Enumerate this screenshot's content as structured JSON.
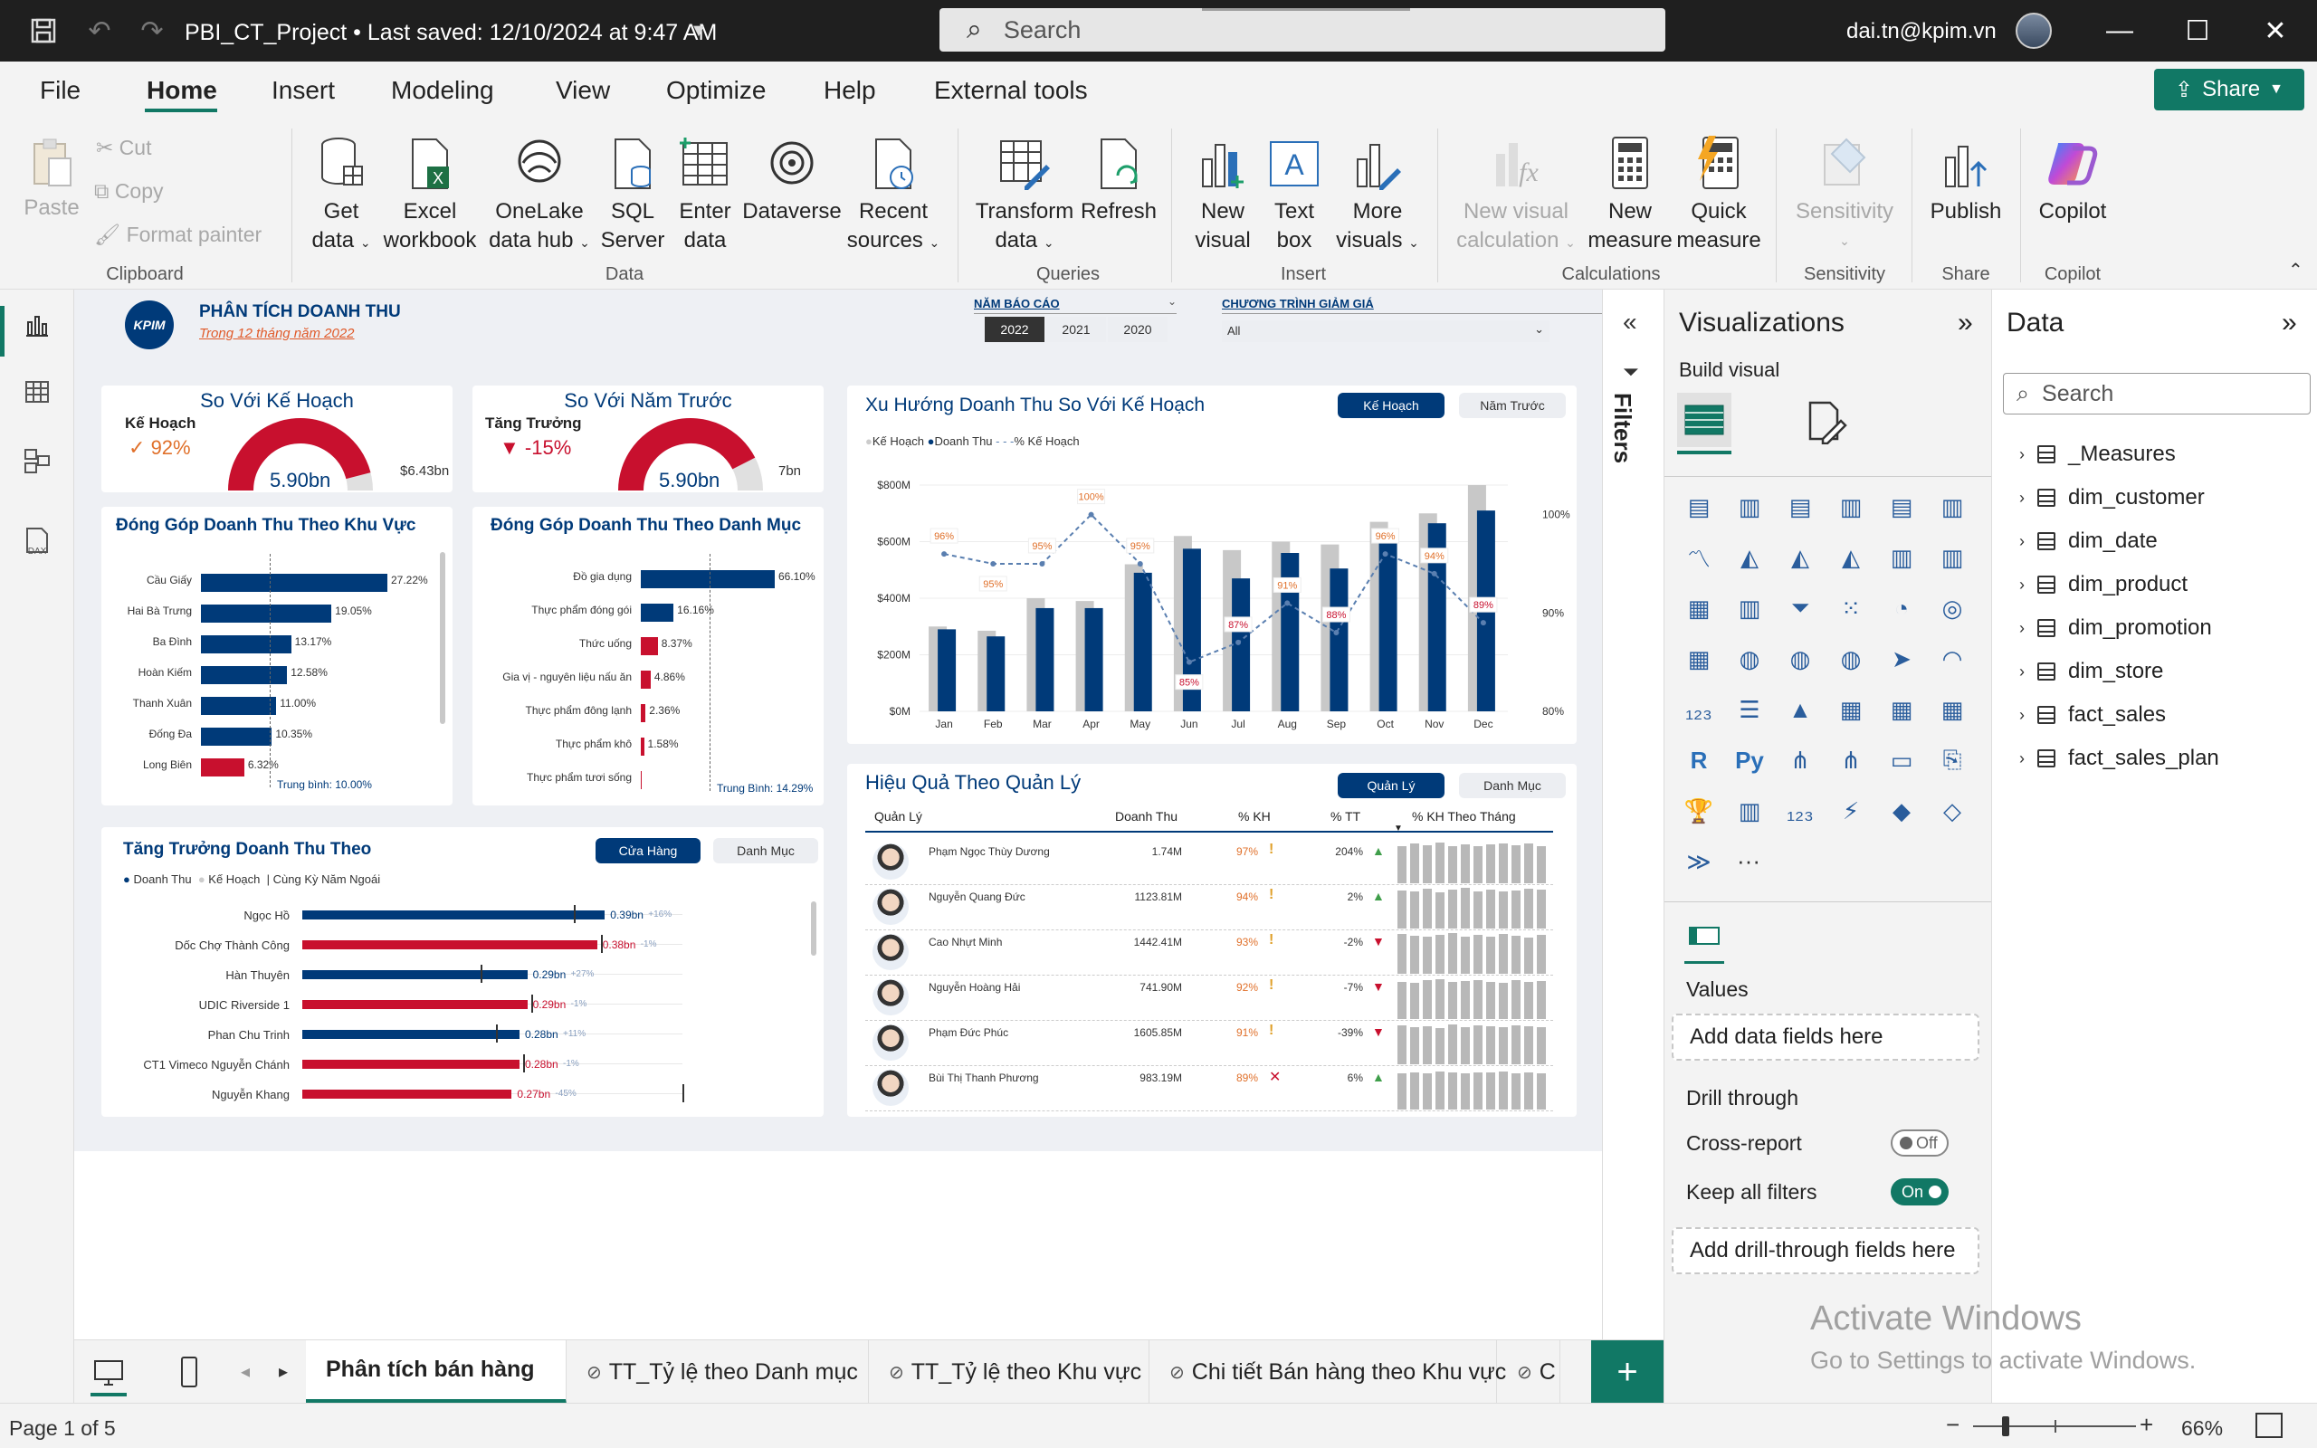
{
  "titlebar": {
    "doc_title": "PBI_CT_Project  •  Last saved: 12/10/2024 at 9:47 AM",
    "search_placeholder": "Search",
    "user_email": "dai.tn@kpim.vn"
  },
  "menu": {
    "items": [
      "File",
      "Home",
      "Insert",
      "Modeling",
      "View",
      "Optimize",
      "Help",
      "External tools"
    ],
    "share": "Share"
  },
  "ribbon": {
    "clipboard": {
      "paste": "Paste",
      "cut": "Cut",
      "copy": "Copy",
      "format_painter": "Format painter",
      "group": "Clipboard"
    },
    "data": {
      "get_data_1": "Get",
      "get_data_2": "data",
      "excel_1": "Excel",
      "excel_2": "workbook",
      "onelake_1": "OneLake",
      "onelake_2": "data hub",
      "sql_1": "SQL",
      "sql_2": "Server",
      "enter_1": "Enter",
      "enter_2": "data",
      "dataverse": "Dataverse",
      "recent_1": "Recent",
      "recent_2": "sources",
      "group": "Data"
    },
    "queries": {
      "transform_1": "Transform",
      "transform_2": "data",
      "refresh": "Refresh",
      "group": "Queries"
    },
    "insert": {
      "new_visual_1": "New",
      "new_visual_2": "visual",
      "text_box_1": "Text",
      "text_box_2": "box",
      "more_visuals_1": "More",
      "more_visuals_2": "visuals",
      "group": "Insert"
    },
    "calculations": {
      "new_visual_calc_1": "New visual",
      "new_visual_calc_2": "calculation",
      "new_measure_1": "New",
      "new_measure_2": "measure",
      "quick_measure_1": "Quick",
      "quick_measure_2": "measure",
      "group": "Calculations"
    },
    "sensitivity": {
      "label": "Sensitivity",
      "group": "Sensitivity"
    },
    "share": {
      "publish": "Publish",
      "group": "Share"
    },
    "copilot": {
      "label": "Copilot",
      "group": "Copilot"
    }
  },
  "report": {
    "logo_text": "KPIM",
    "title": "PHÂN TÍCH DOANH THU",
    "subtitle": "Trong 12 tháng năm 2022",
    "year_slicer": {
      "label": "NĂM BÁO CÁO",
      "options": [
        "2022",
        "2021",
        "2020"
      ],
      "selected": "2022"
    },
    "promo_slicer": {
      "label": "CHƯƠNG TRÌNH GIẢM GIÁ",
      "value": "All"
    },
    "gauge_plan": {
      "title": "So Với Kế Hoạch",
      "label": "Kế Hoạch",
      "pct": "92%",
      "pct_mark": "✓",
      "value": "5.90bn",
      "target": "$6.43bn",
      "fill": 0.92
    },
    "gauge_prev": {
      "title": "So Với Năm Trước",
      "label": "Tăng Trưởng",
      "pct": "-15%",
      "pct_mark": "▼",
      "value": "5.90bn",
      "target": "7bn",
      "fill": 0.85
    },
    "region": {
      "title": "Đóng Góp Doanh Thu Theo Khu Vực",
      "avg": "Trung bình: 10.00%",
      "rows": [
        {
          "name": "Cầu Giấy",
          "label": "27.22%",
          "value": 27.22,
          "color": "#003a79"
        },
        {
          "name": "Hai Bà Trưng",
          "label": "19.05%",
          "value": 19.05,
          "color": "#003a79"
        },
        {
          "name": "Ba Đình",
          "label": "13.17%",
          "value": 13.17,
          "color": "#003a79"
        },
        {
          "name": "Hoàn Kiếm",
          "label": "12.58%",
          "value": 12.58,
          "color": "#003a79"
        },
        {
          "name": "Thanh Xuân",
          "label": "11.00%",
          "value": 11.0,
          "color": "#003a79"
        },
        {
          "name": "Đống Đa",
          "label": "10.35%",
          "value": 10.35,
          "color": "#003a79"
        },
        {
          "name": "Long Biên",
          "label": "6.32%",
          "value": 6.32,
          "color": "#c8102e"
        }
      ]
    },
    "category": {
      "title": "Đóng Góp Doanh Thu Theo Danh Mục",
      "avg": "Trung Bình: 14.29%",
      "rows": [
        {
          "name": "Đồ gia dụng",
          "label": "66.10%",
          "value": 66.1,
          "color": "#003a79"
        },
        {
          "name": "Thực phẩm đóng gói",
          "label": "16.16%",
          "value": 16.16,
          "color": "#003a79"
        },
        {
          "name": "Thức uống",
          "label": "8.37%",
          "value": 8.37,
          "color": "#c8102e"
        },
        {
          "name": "Gia vị - nguyên liệu nấu ăn",
          "label": "4.86%",
          "value": 4.86,
          "color": "#c8102e"
        },
        {
          "name": "Thực phẩm đông lạnh",
          "label": "2.36%",
          "value": 2.36,
          "color": "#c8102e"
        },
        {
          "name": "Thực phẩm khô",
          "label": "1.58%",
          "value": 1.58,
          "color": "#c8102e"
        },
        {
          "name": "Thực phẩm tươi sống",
          "label": "",
          "value": 0.6,
          "color": "#c8102e"
        }
      ]
    },
    "growth": {
      "title": "Tăng Trưởng Doanh Thu Theo",
      "tab_on": "Cửa Hàng",
      "tab_off": "Danh Mục",
      "legend": [
        "Doanh Thu",
        "Kế Hoạch",
        "Cùng Kỳ Năm Ngoái"
      ],
      "rows": [
        {
          "name": "Ngọc Hồ",
          "label": "0.39bn",
          "delta": "+16%",
          "value": 0.39,
          "color": "#003a79",
          "ly": 0.35
        },
        {
          "name": "Dốc Chợ Thành Công",
          "label": "0.38bn",
          "delta": "-1%",
          "value": 0.38,
          "color": "#c8102e",
          "ly": 0.385
        },
        {
          "name": "Hàn Thuyên",
          "label": "0.29bn",
          "delta": "+27%",
          "value": 0.29,
          "color": "#003a79",
          "ly": 0.23
        },
        {
          "name": "UDIC Riverside 1",
          "label": "0.29bn",
          "delta": "-1%",
          "value": 0.29,
          "color": "#c8102e",
          "ly": 0.295
        },
        {
          "name": "Phan Chu Trinh",
          "label": "0.28bn",
          "delta": "+11%",
          "value": 0.28,
          "color": "#003a79",
          "ly": 0.25
        },
        {
          "name": "CT1 Vimeco Nguyễn Chánh",
          "label": "0.28bn",
          "delta": "-1%",
          "value": 0.28,
          "color": "#c8102e",
          "ly": 0.285
        },
        {
          "name": "Nguyễn Khang",
          "label": "0.27bn",
          "delta": "-45%",
          "value": 0.27,
          "color": "#c8102e",
          "ly": 0.49
        }
      ]
    },
    "trend": {
      "title": "Xu Hướng Doanh Thu So Với Kế Hoạch",
      "tab_on": "Kế Hoạch",
      "tab_off": "Năm Trước",
      "legend": [
        "Kế Hoạch",
        "Doanh Thu",
        "% Kế Hoạch"
      ],
      "y_ticks": [
        "$0M",
        "$200M",
        "$400M",
        "$600M",
        "$800M"
      ],
      "y2_ticks": [
        "80%",
        "90%",
        "100%"
      ]
    },
    "managers": {
      "title": "Hiệu Quả Theo Quản Lý",
      "tab_on": "Quản Lý",
      "tab_off": "Danh Mục",
      "headers": [
        "Quản Lý",
        "Doanh Thu",
        "% KH",
        "% TT",
        "% KH Theo Tháng"
      ],
      "rows": [
        {
          "name": "Phạm Ngọc Thùy Dương",
          "revenue": "1.74M",
          "kh": "97%",
          "kh_mark": "!",
          "tt": "204%",
          "tt_mark": "▲"
        },
        {
          "name": "Nguyễn Quang Đức",
          "revenue": "1123.81M",
          "kh": "94%",
          "kh_mark": "!",
          "tt": "2%",
          "tt_mark": "▲"
        },
        {
          "name": "Cao Nhựt Minh",
          "revenue": "1442.41M",
          "kh": "93%",
          "kh_mark": "!",
          "tt": "-2%",
          "tt_mark": "▼"
        },
        {
          "name": "Nguyễn Hoàng Hải",
          "revenue": "741.90M",
          "kh": "92%",
          "kh_mark": "!",
          "tt": "-7%",
          "tt_mark": "▼"
        },
        {
          "name": "Phạm Đức Phúc",
          "revenue": "1605.85M",
          "kh": "91%",
          "kh_mark": "!",
          "tt": "-39%",
          "tt_mark": "▼"
        },
        {
          "name": "Bùi Thị Thanh Phương",
          "revenue": "983.19M",
          "kh": "89%",
          "kh_mark": "✕",
          "tt": "6%",
          "tt_mark": "▲"
        }
      ]
    }
  },
  "chart_data": {
    "type": "bar",
    "title": "Xu Hướng Doanh Thu So Với Kế Hoạch",
    "categories": [
      "Jan",
      "Feb",
      "Mar",
      "Apr",
      "May",
      "Jun",
      "Jul",
      "Aug",
      "Sep",
      "Oct",
      "Nov",
      "Dec"
    ],
    "series": [
      {
        "name": "Kế Hoạch",
        "values": [
          300,
          285,
          400,
          390,
          520,
          620,
          570,
          600,
          590,
          670,
          700,
          800
        ],
        "color": "#c8c8c8"
      },
      {
        "name": "Doanh Thu",
        "values": [
          290,
          265,
          365,
          365,
          490,
          575,
          470,
          560,
          505,
          630,
          665,
          710
        ],
        "color": "#003a79"
      },
      {
        "name": "% Kế Hoạch",
        "values": [
          96,
          95,
          95,
          100,
          95,
          85,
          87,
          91,
          88,
          96,
          94,
          89
        ],
        "color": "#5a7fb0"
      }
    ],
    "ylabel": "",
    "ylim": [
      0,
      800
    ],
    "y2lim": [
      80,
      100
    ]
  },
  "filters": {
    "label": "Filters"
  },
  "viz": {
    "title": "Visualizations",
    "build_visual": "Build visual",
    "values_label": "Values",
    "values_placeholder": "Add data fields here",
    "drill_through": "Drill through",
    "cross_report": "Cross-report",
    "cross_report_state": "Off",
    "keep_filters": "Keep all filters",
    "keep_filters_state": "On",
    "drill_placeholder": "Add drill-through fields here",
    "more": "···"
  },
  "datapane": {
    "title": "Data",
    "search_placeholder": "Search",
    "items": [
      "_Measures",
      "dim_customer",
      "dim_date",
      "dim_product",
      "dim_promotion",
      "dim_store",
      "fact_sales",
      "fact_sales_plan"
    ]
  },
  "tabs": [
    "Phân tích bán hàng",
    "TT_Tỷ lệ theo Danh mục",
    "TT_Tỷ lệ theo Khu vực",
    "Chi tiết Bán hàng theo Khu vực",
    "C"
  ],
  "status": {
    "page": "Page 1 of 5",
    "zoom": "66%"
  },
  "watermark": {
    "line1": "Activate Windows",
    "line2": "Go to Settings to activate Windows."
  }
}
